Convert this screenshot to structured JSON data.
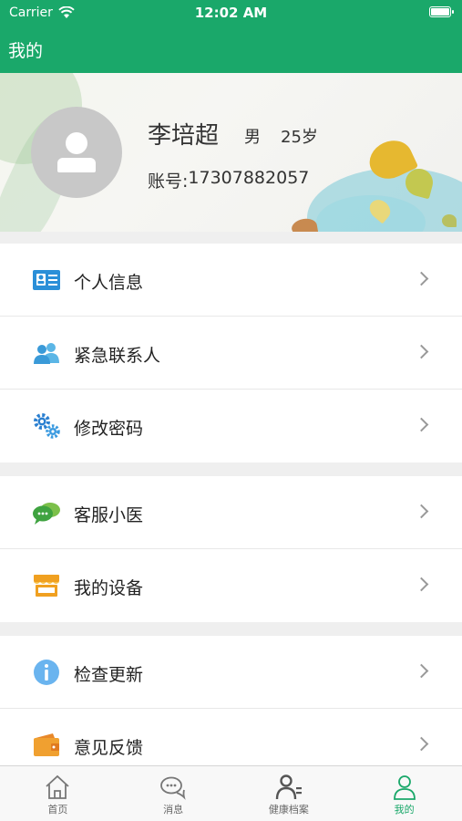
{
  "status_bar": {
    "carrier": "Carrier",
    "time": "12:02 AM"
  },
  "nav": {
    "title": "我的"
  },
  "profile": {
    "name": "李培超",
    "gender": "男",
    "age": "25岁",
    "account_label": "账号:",
    "account_number": "17307882057"
  },
  "menu": {
    "personal_info": "个人信息",
    "emergency_contact": "紧急联系人",
    "change_password": "修改密码",
    "customer_service": "客服小医",
    "my_devices": "我的设备",
    "check_update": "检查更新",
    "feedback": "意见反馈"
  },
  "tabs": {
    "home": "首页",
    "messages": "消息",
    "health_records": "健康档案",
    "mine": "我的"
  },
  "colors": {
    "brand_green": "#1aa86a",
    "icon_blue": "#2a8fd8",
    "icon_green": "#3fa340",
    "icon_orange": "#f0a020"
  }
}
